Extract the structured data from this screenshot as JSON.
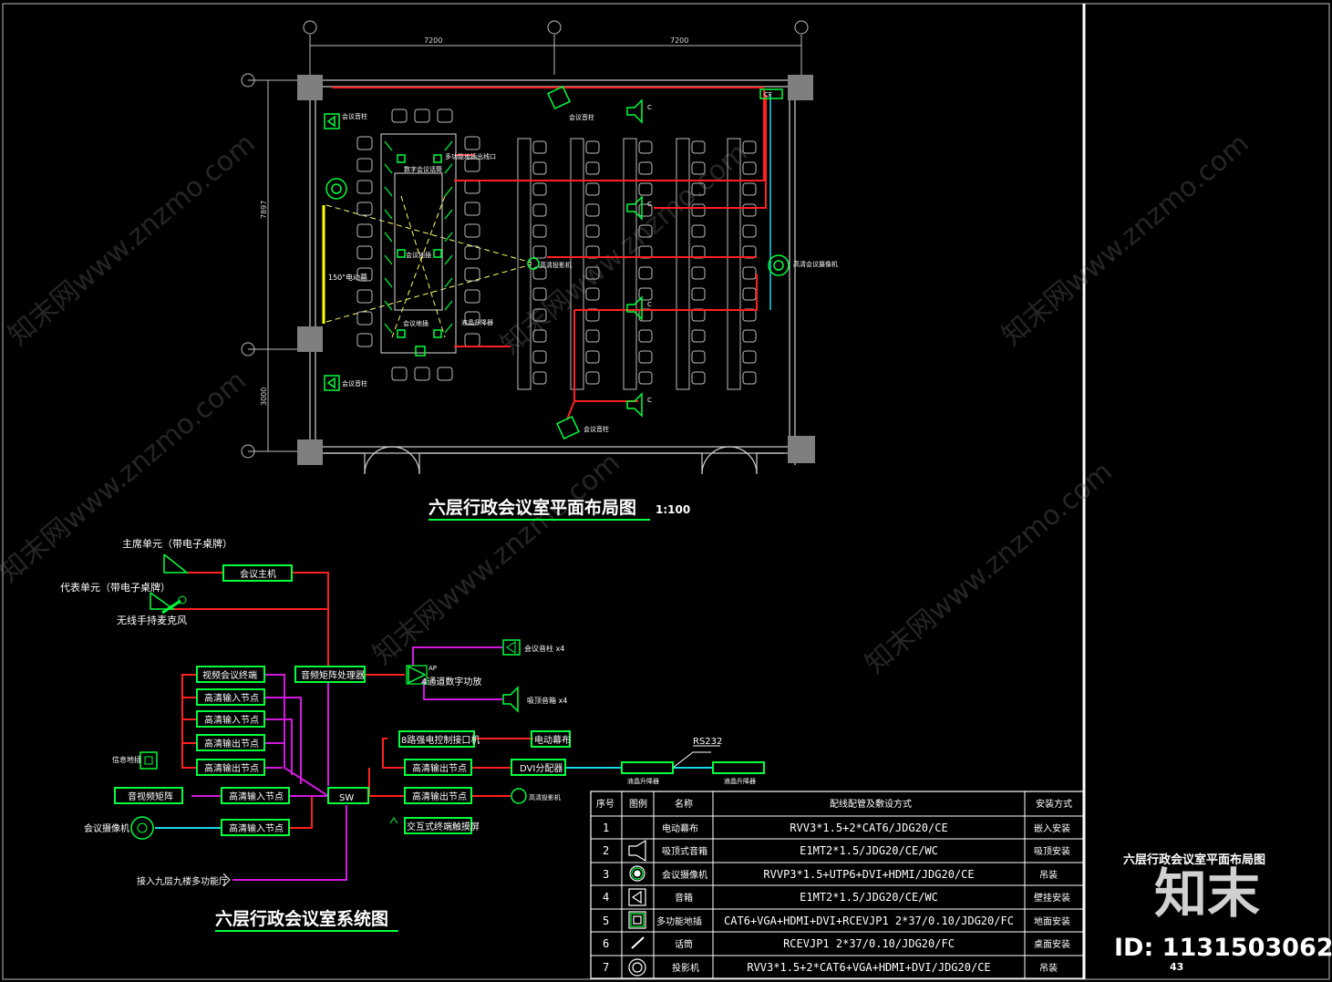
{
  "plan": {
    "dims": {
      "top_left": "7200",
      "top_right": "7200",
      "side_upper": "7897",
      "side_lower": "3000"
    },
    "title": "六层行政会议室平面布局图",
    "scale": "1:100",
    "labels": {
      "screen": "150\"电动幕",
      "spk_top": "会议音柱",
      "spk_bot": "会议音柱",
      "spk_tr": "会议音柱",
      "spk_br": "会议音柱",
      "mic_top": "数字会议话筒",
      "floor_box": "多功能地插出线口",
      "podium1": "会议地插",
      "podium2": "会议地插",
      "camera": "高清投影机",
      "lcd": "液晶升降器",
      "cam_right": "高清会议摄像机",
      "cf": "CF"
    }
  },
  "system": {
    "title": "六层行政会议室系统图",
    "chair_unit": "主席单元（带电子桌牌）",
    "delegate_unit": "代表单元（带电子桌牌）",
    "wireless_mic": "无线手持麦克风",
    "boxes": {
      "host": "会议主机",
      "matrix": "音频矩阵处理器",
      "vc_terminal": "视频会议终端",
      "in1": "高清输入节点",
      "in2": "高清输入节点",
      "out1": "高清输出节点",
      "out2": "高清输出节点",
      "av_matrix": "音视频矩阵",
      "in3": "高清输入节点",
      "in4": "高清输入节点",
      "sw": "SW",
      "relay": "8路强电控制接口机",
      "e_screen": "电动幕布",
      "out3": "高清输出节点",
      "dvi": "DVI分配器",
      "out4": "高清输出节点",
      "touch": "交互式终端触摸屏",
      "lcd1": "",
      "lcd2": ""
    },
    "amp": "4通道数字功放",
    "amp_ap": "AP",
    "spk_wall": "会议音柱 x4",
    "spk_ceiling": "吸顶音箱 x4",
    "floor_socket": "信息地插",
    "camera": "会议摄像机",
    "projector": "高清投影机",
    "rs232": "RS232",
    "lcd_a": "液晶升降器",
    "lcd_b": "液晶升降器",
    "ninth_floor": "接入九层九楼多功能厅"
  },
  "table": {
    "headers": [
      "序号",
      "图例",
      "名称",
      "配线配管及敷设方式",
      "安装方式"
    ],
    "rows": [
      {
        "no": "1",
        "name": "电动幕布",
        "wiring": "RVV3*1.5+2*CAT6/JDG20/CE",
        "install": "嵌入安装"
      },
      {
        "no": "2",
        "name": "吸顶式音箱",
        "wiring": "E1MT2*1.5/JDG20/CE/WC",
        "install": "吸顶安装"
      },
      {
        "no": "3",
        "name": "会议摄像机",
        "wiring": "RVVP3*1.5+UTP6+DVI+HDMI/JDG20/CE",
        "install": "吊装"
      },
      {
        "no": "4",
        "name": "音箱",
        "wiring": "E1MT2*1.5/JDG20/CE/WC",
        "install": "壁挂安装"
      },
      {
        "no": "5",
        "name": "多功能地插",
        "wiring": "CAT6+VGA+HDMI+DVI+RCEVJP1 2*37/0.10/JDG20/FC",
        "install": "地面安装"
      },
      {
        "no": "6",
        "name": "话筒",
        "wiring": "RCEVJP1 2*37/0.10/JDG20/FC",
        "install": "桌面安装"
      },
      {
        "no": "7",
        "name": "投影机",
        "wiring": "RVV3*1.5+2*CAT6+VGA+HDMI+DVI/JDG20/CE",
        "install": "吊装"
      }
    ]
  },
  "sidebar": {
    "title": "六层行政会议室平面布局图",
    "logo": "知末",
    "id_label": "ID: 1131503062",
    "page": "43"
  },
  "watermark": "知末网www.znzmo.com",
  "colors": {
    "green": "#00ff3c",
    "red": "#ff2020",
    "magenta": "#d21adf",
    "cyan": "#19d9e8",
    "yellow": "#ffff00",
    "grey": "#7f7f7f"
  }
}
